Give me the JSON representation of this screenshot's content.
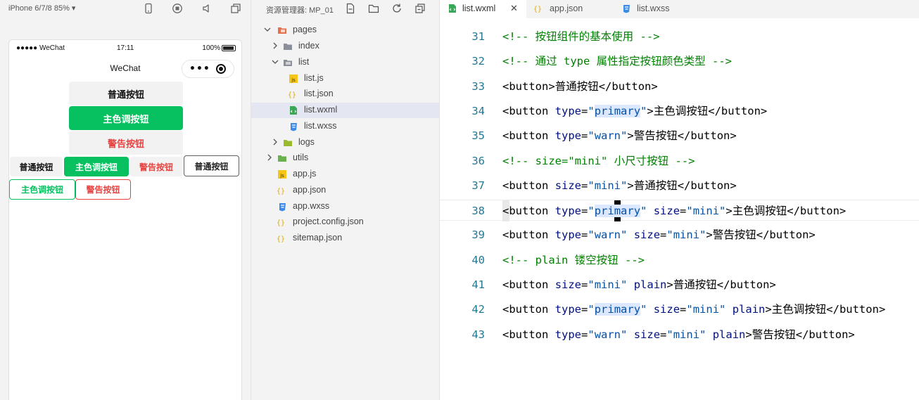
{
  "simulator": {
    "device": "iPhone 6/7/8 85% ▾",
    "status": {
      "carrier": "●●●●● WeChat",
      "time": "17:11",
      "battery": "100%"
    },
    "nav_title": "WeChat",
    "capsule_dots": "•••",
    "buttons": {
      "default": "普通按钮",
      "primary": "主色调按钮",
      "warn": "警告按钮",
      "mini_default": "普通按钮",
      "mini_primary": "主色调按钮",
      "mini_warn": "警告按钮",
      "plain_default": "普通按钮",
      "plain_primary": "主色调按钮",
      "plain_warn": "警告按钮"
    }
  },
  "explorer": {
    "title": "资源管理器: MP_01",
    "tree": [
      {
        "label": "pages",
        "type": "folder",
        "expanded": true
      },
      {
        "label": "index",
        "type": "folder",
        "expanded": false
      },
      {
        "label": "list",
        "type": "folder",
        "expanded": true
      },
      {
        "label": "list.js",
        "type": "js"
      },
      {
        "label": "list.json",
        "type": "json"
      },
      {
        "label": "list.wxml",
        "type": "wxml",
        "selected": true
      },
      {
        "label": "list.wxss",
        "type": "wxss"
      },
      {
        "label": "logs",
        "type": "folder",
        "expanded": false
      },
      {
        "label": "utils",
        "type": "folder",
        "expanded": false
      },
      {
        "label": "app.js",
        "type": "js"
      },
      {
        "label": "app.json",
        "type": "json"
      },
      {
        "label": "app.wxss",
        "type": "wxss"
      },
      {
        "label": "project.config.json",
        "type": "json"
      },
      {
        "label": "sitemap.json",
        "type": "json"
      }
    ]
  },
  "editor": {
    "tabs": [
      {
        "label": "list.wxml",
        "active": true,
        "close": "✕"
      },
      {
        "label": "app.json",
        "active": false
      },
      {
        "label": "list.wxss",
        "active": false
      }
    ],
    "lines": [
      {
        "no": "31",
        "text": "<!-- 按钮组件的基本使用 -->"
      },
      {
        "no": "32",
        "text": "<!-- 通过 type 属性指定按钮颜色类型 -->"
      },
      {
        "no": "33",
        "text": "<button>普通按钮</button>"
      },
      {
        "no": "34",
        "text": "<button type=\"primary\">主色调按钮</button>"
      },
      {
        "no": "35",
        "text": "<button type=\"warn\">警告按钮</button>"
      },
      {
        "no": "36",
        "text": "<!-- size=\"mini\" 小尺寸按钮 -->"
      },
      {
        "no": "37",
        "text": "<button size=\"mini\">普通按钮</button>"
      },
      {
        "no": "38",
        "text": "<button type=\"primary\" size=\"mini\">主色调按钮</button>",
        "current": true
      },
      {
        "no": "39",
        "text": "<button type=\"warn\" size=\"mini\">警告按钮</button>"
      },
      {
        "no": "40",
        "text": "<!-- plain 镂空按钮 -->"
      },
      {
        "no": "41",
        "text": "<button size=\"mini\" plain>普通按钮</button>"
      },
      {
        "no": "42",
        "text": "<button type=\"primary\" size=\"mini\" plain>主色调按钮</button>"
      },
      {
        "no": "43",
        "text": "<button type=\"warn\" size=\"mini\" plain>警告按钮</button>"
      }
    ]
  },
  "colors": {
    "primary": "#07c160",
    "warn": "#e64340",
    "comment": "#008000",
    "attr": "#001080",
    "value": "#0451a5",
    "line_number": "#237893"
  }
}
